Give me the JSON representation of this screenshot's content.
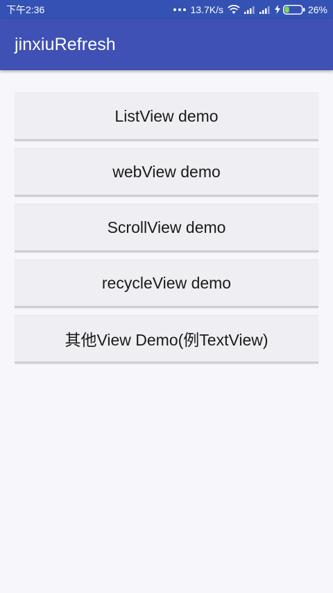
{
  "status_bar": {
    "time": "下午2:36",
    "net_speed": "13.7K/s",
    "battery_percent": "26%",
    "battery_level": 0.26,
    "icons": [
      "more-dots-icon",
      "wifi-icon",
      "signal-icon",
      "signal-icon",
      "charging-icon",
      "battery-icon"
    ]
  },
  "app_bar": {
    "title": "jinxiuRefresh"
  },
  "buttons": [
    {
      "label": "ListView demo"
    },
    {
      "label": "webView demo"
    },
    {
      "label": "ScrollView demo"
    },
    {
      "label": "recycleView demo"
    },
    {
      "label": "其他View Demo(例TextView)"
    }
  ],
  "colors": {
    "status_bar": "#3452b3",
    "app_bar": "#3f51b5",
    "background": "#f7f6fa",
    "button_bg": "#efeef2",
    "battery_fill": "#7ed957"
  }
}
